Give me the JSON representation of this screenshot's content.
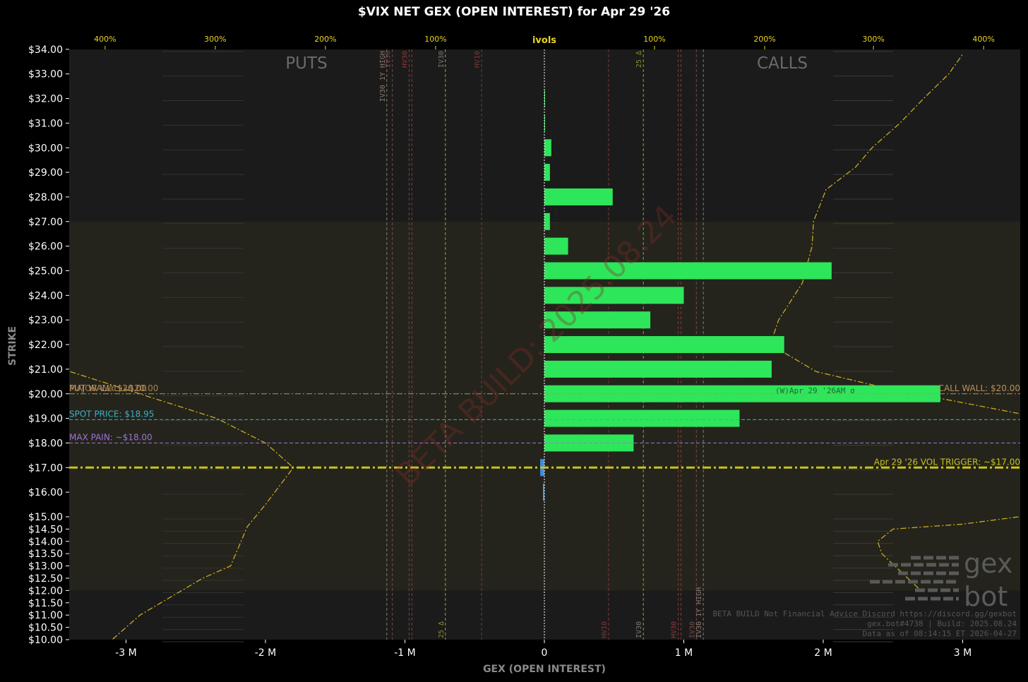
{
  "chart_data": {
    "type": "bar",
    "orientation": "horizontal",
    "title": "$VIX NET GEX (OPEN INTEREST) for Apr 29 '26",
    "xlabel": "GEX (OPEN INTEREST)",
    "ylabel": "STRIKE",
    "top_axis_label": "ivols",
    "x_range": [
      -3.4,
      3.4
    ],
    "x_unit_label": "M",
    "x_ticks": [
      {
        "value": -3,
        "label": "-3 M"
      },
      {
        "value": -2,
        "label": "-2 M"
      },
      {
        "value": -1,
        "label": "-1 M"
      },
      {
        "value": 0,
        "label": "0"
      },
      {
        "value": 1,
        "label": "1 M"
      },
      {
        "value": 2,
        "label": "2 M"
      },
      {
        "value": 3,
        "label": "3 M"
      }
    ],
    "top_ticks": [
      {
        "value": -3.15,
        "label": "400%"
      },
      {
        "value": -2.36,
        "label": "300%"
      },
      {
        "value": -1.57,
        "label": "200%"
      },
      {
        "value": -0.78,
        "label": "100%"
      },
      {
        "value": 0.79,
        "label": "100%"
      },
      {
        "value": 1.58,
        "label": "200%"
      },
      {
        "value": 2.36,
        "label": "300%"
      },
      {
        "value": 3.15,
        "label": "400%"
      }
    ],
    "y_ticks": [
      {
        "value": 34,
        "label": "$34.00"
      },
      {
        "value": 33,
        "label": "$33.00"
      },
      {
        "value": 32,
        "label": "$32.00"
      },
      {
        "value": 31,
        "label": "$31.00"
      },
      {
        "value": 30,
        "label": "$30.00"
      },
      {
        "value": 29,
        "label": "$29.00"
      },
      {
        "value": 28,
        "label": "$28.00"
      },
      {
        "value": 27,
        "label": "$27.00"
      },
      {
        "value": 26,
        "label": "$26.00"
      },
      {
        "value": 25,
        "label": "$25.00"
      },
      {
        "value": 24,
        "label": "$24.00"
      },
      {
        "value": 23,
        "label": "$23.00"
      },
      {
        "value": 22,
        "label": "$22.00"
      },
      {
        "value": 21,
        "label": "$21.00"
      },
      {
        "value": 20,
        "label": "$20.00"
      },
      {
        "value": 19,
        "label": "$19.00"
      },
      {
        "value": 18,
        "label": "$18.00"
      },
      {
        "value": 17,
        "label": "$17.00"
      },
      {
        "value": 16,
        "label": "$16.00"
      },
      {
        "value": 15,
        "label": "$15.00"
      },
      {
        "value": 14.5,
        "label": "$14.50"
      },
      {
        "value": 14,
        "label": "$14.00"
      },
      {
        "value": 13.5,
        "label": "$13.50"
      },
      {
        "value": 13,
        "label": "$13.00"
      },
      {
        "value": 12.5,
        "label": "$12.50"
      },
      {
        "value": 12,
        "label": "$12.00"
      },
      {
        "value": 11.5,
        "label": "$11.50"
      },
      {
        "value": 11,
        "label": "$11.00"
      },
      {
        "value": 10.5,
        "label": "$10.50"
      },
      {
        "value": 10,
        "label": "$10.00"
      }
    ],
    "bars": [
      {
        "strike": 32,
        "value": 0.003
      },
      {
        "strike": 31,
        "value": 0.002
      },
      {
        "strike": 30,
        "value": 0.05
      },
      {
        "strike": 29,
        "value": 0.04
      },
      {
        "strike": 28,
        "value": 0.49
      },
      {
        "strike": 27,
        "value": 0.04
      },
      {
        "strike": 26,
        "value": 0.17
      },
      {
        "strike": 25,
        "value": 2.06
      },
      {
        "strike": 24,
        "value": 1.0
      },
      {
        "strike": 23,
        "value": 0.76
      },
      {
        "strike": 22,
        "value": 1.72
      },
      {
        "strike": 21,
        "value": 1.63
      },
      {
        "strike": 20,
        "value": 2.84
      },
      {
        "strike": 19,
        "value": 1.4
      },
      {
        "strike": 18,
        "value": 0.64
      },
      {
        "strike": 17,
        "value": -0.03
      },
      {
        "strike": 16,
        "value": -0.01
      }
    ],
    "side_labels": {
      "puts": "PUTS",
      "calls": "CALLS"
    },
    "levels": [
      {
        "id": "call-wall",
        "strike": 20,
        "left_text": "PUT WALL: $20.00",
        "left_text_2": "MAJOR WALL: $20.00",
        "right_text": "CALL WALL: $20.00",
        "color": "#b8915a"
      },
      {
        "id": "spot",
        "strike": 18.95,
        "left_text": "SPOT PRICE: $18.95",
        "color": "#3ab0c8"
      },
      {
        "id": "max-pain",
        "strike": 18,
        "left_text": "MAX PAIN: ~$18.00",
        "color": "#9e74d8"
      },
      {
        "id": "vol-trigger",
        "strike": 17,
        "right_text": "Apr 29 '26 VOL TRIGGER: ~$17.00",
        "color": "#c9c21d"
      }
    ],
    "vlines": [
      {
        "x": -1.13,
        "label": "IV30 1Y HIGH",
        "color": "#8a7a6a",
        "pos": "top"
      },
      {
        "x": -1.09,
        "label": "IV30",
        "color": "#7a4a4a",
        "pos": "top"
      },
      {
        "x": -0.97,
        "label": "HV30",
        "color": "#8a3a3a",
        "pos": "top"
      },
      {
        "x": -0.95,
        "label": "",
        "color": "#8a3a3a",
        "pos": "top"
      },
      {
        "x": -0.71,
        "label": "IV30",
        "color": "#777777",
        "pos": "top"
      },
      {
        "x": -0.71,
        "label": "25 Δ",
        "color": "#8a8a2a",
        "pos": "bottom"
      },
      {
        "x": -0.45,
        "label": "HV10",
        "color": "#7a3a3a",
        "pos": "top"
      },
      {
        "x": 0.46,
        "label": "HV10",
        "color": "#7a3a3a",
        "pos": "bottom"
      },
      {
        "x": 0.71,
        "label": "IV30",
        "color": "#777777",
        "pos": "bottom"
      },
      {
        "x": 0.71,
        "label": "25 Δ",
        "color": "#8a8a2a",
        "pos": "top"
      },
      {
        "x": 0.96,
        "label": "HV30",
        "color": "#8a3a3a",
        "pos": "bottom"
      },
      {
        "x": 0.98,
        "label": "",
        "color": "#8a3a3a",
        "pos": "bottom"
      },
      {
        "x": 1.09,
        "label": "IV30",
        "color": "#7a4a4a",
        "pos": "bottom"
      },
      {
        "x": 1.14,
        "label": "IV30 1Y HIGH",
        "color": "#8a7a6a",
        "pos": "bottom"
      }
    ],
    "zone_band": {
      "from": 12,
      "to": 27,
      "color": "#24241c"
    },
    "put_ivol_curve": [
      [
        -3.4,
        20.9
      ],
      [
        -2.35,
        19.0
      ],
      [
        -2.0,
        18.0
      ],
      [
        -1.8,
        17.0
      ],
      [
        -2.0,
        15.5
      ],
      [
        -2.13,
        14.6
      ],
      [
        -2.25,
        13.0
      ],
      [
        -2.45,
        12.5
      ],
      [
        -2.9,
        11.0
      ],
      [
        -3.1,
        10.0
      ]
    ],
    "call_ivol_curve": [
      [
        3.4,
        19.2
      ],
      [
        2.85,
        19.8
      ],
      [
        2.4,
        20.3
      ],
      [
        1.95,
        20.9
      ],
      [
        1.62,
        22.0
      ],
      [
        1.68,
        23.0
      ],
      [
        1.85,
        24.5
      ],
      [
        1.92,
        26.0
      ],
      [
        1.93,
        27.0
      ],
      [
        2.02,
        28.3
      ],
      [
        2.23,
        29.2
      ],
      [
        2.35,
        30.0
      ],
      [
        2.55,
        31.0
      ],
      [
        2.72,
        32.0
      ],
      [
        2.9,
        33.0
      ],
      [
        3.0,
        33.8
      ]
    ],
    "call_ivol_curve_low": [
      [
        3.4,
        15.0
      ],
      [
        3.0,
        14.7
      ],
      [
        2.5,
        14.5
      ],
      [
        2.39,
        14.0
      ],
      [
        2.42,
        13.5
      ],
      [
        2.55,
        12.8
      ],
      [
        2.7,
        12.0
      ]
    ],
    "dashed_curve": [
      [
        0.1,
        17.8
      ],
      [
        0.2,
        18.3
      ],
      [
        0.5,
        19.0
      ],
      [
        1.1,
        20.0
      ],
      [
        1.6,
        21.0
      ]
    ],
    "dotted_curve": [
      [
        0.05,
        28.0
      ],
      [
        0.08,
        27.5
      ],
      [
        0.1,
        25.0
      ],
      [
        0.12,
        24.0
      ],
      [
        0.3,
        23.5
      ],
      [
        0.5,
        23.0
      ],
      [
        0.9,
        22.5
      ],
      [
        1.2,
        21.8
      ],
      [
        1.45,
        21.0
      ],
      [
        1.9,
        20.0
      ],
      [
        2.2,
        19.5
      ]
    ],
    "watermark": "BETA BUILD: 2025.08.24",
    "footer_lines": [
      "BETA BUILD Not Financial Advice Discord https://discord.gg/gexbot",
      "gex.bot#4738 | Build: 2025.08.24",
      "Data as of 08:14:15 ET 2026-04-27"
    ],
    "inline_label": "(W)Apr 29 '26AM σ",
    "logo_text": [
      "gex",
      "bot"
    ],
    "colors": {
      "positive_bar": "#2ee65a",
      "negative_bar": "#3a8ee6",
      "ivol_curve": "#c9a820",
      "background": "#000000",
      "plot_bg": "#1b1b1b",
      "tick_top": "#e8d420"
    }
  }
}
